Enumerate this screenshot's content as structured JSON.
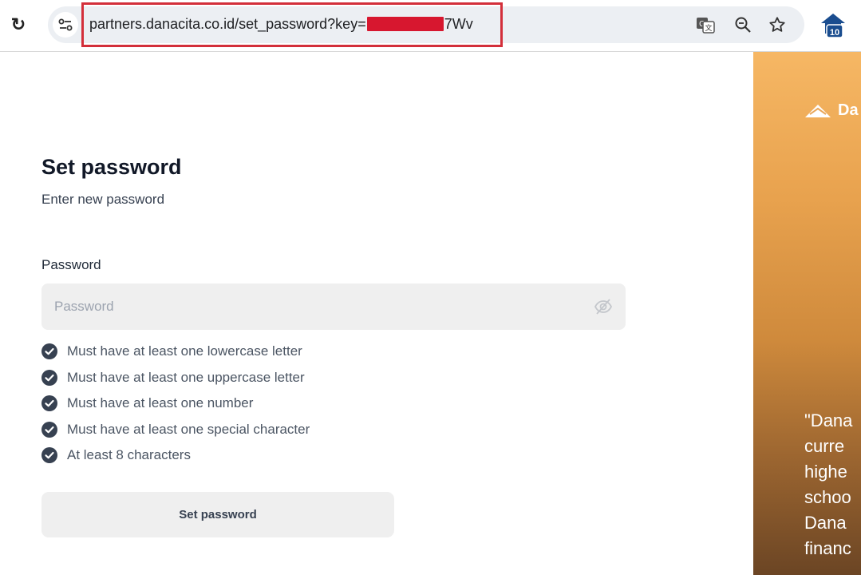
{
  "browser": {
    "url_prefix": "partners.danacita.co.id/set_password?key=",
    "url_suffix": "7Wv",
    "extension_badge": "10"
  },
  "form": {
    "title": "Set password",
    "subtitle": "Enter new password",
    "password_label": "Password",
    "password_placeholder": "Password",
    "requirements": [
      "Must have at least one lowercase letter",
      "Must have at least one uppercase letter",
      "Must have at least one number",
      "Must have at least one special character",
      "At least 8 characters"
    ],
    "submit_label": "Set password"
  },
  "panel": {
    "brand": "Da",
    "quote": "\"Dana\ncurre\nhighe\nschoo\nDana\nfinanc"
  },
  "colors": {
    "redaction": "#d7172f",
    "url_highlight": "#d32f3a",
    "check": "#374151"
  }
}
